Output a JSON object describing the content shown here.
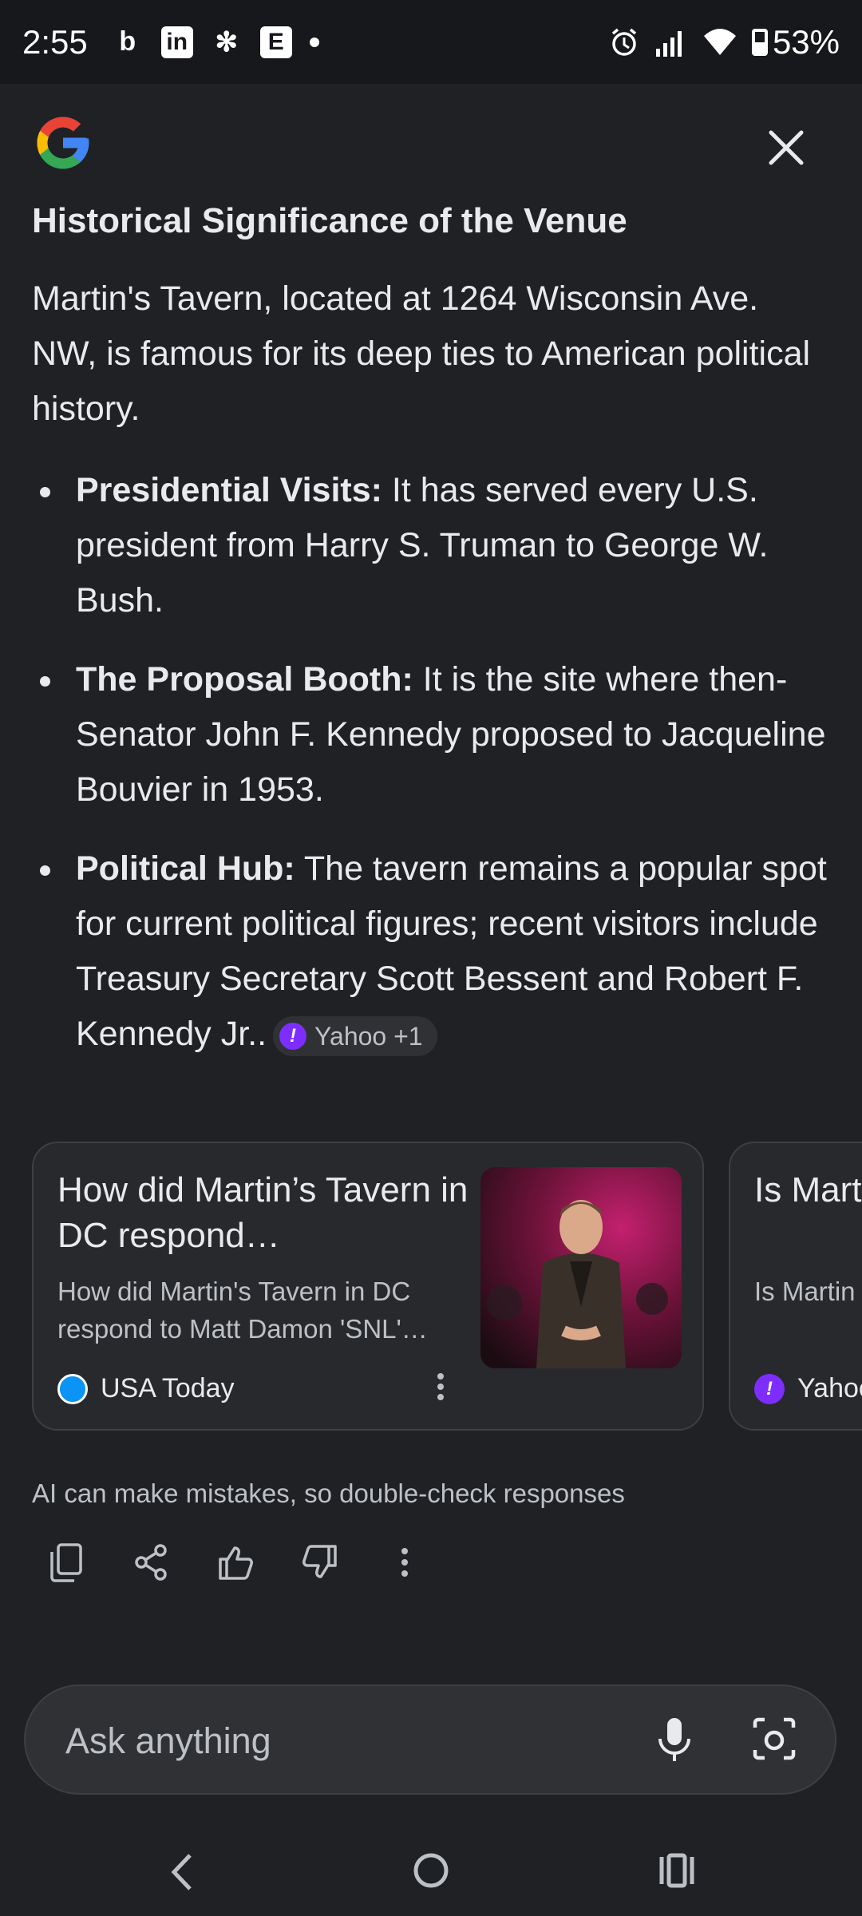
{
  "status_bar": {
    "time": "2:55",
    "battery": "53%",
    "app_icons": [
      "b",
      "in",
      "✻",
      "E"
    ]
  },
  "header": {
    "logo": "google-g-icon",
    "close_icon": "close-icon"
  },
  "content": {
    "heading": "Historical Significance of the Venue",
    "intro": "Martin's Tavern, located at 1264 Wisconsin Ave. NW, is famous for its deep ties to American political history.",
    "bullets": [
      {
        "label": "Presidential Visits:",
        "text": " It has served every U.S. president from Harry S. Truman to George W. Bush."
      },
      {
        "label": "The Proposal Booth:",
        "text": " It is the site where then-Senator John F. Kennedy proposed to Jacqueline Bouvier in 1953."
      },
      {
        "label": "Political Hub:",
        "text": " The tavern remains a popular spot for current political figures; recent visitors include Treasury Secretary Scott Bessent and Robert F. Kennedy Jr.."
      }
    ],
    "source_chip": "Yahoo +1"
  },
  "cards": [
    {
      "title": "How did Martin’s Tavern in DC respond…",
      "snippet": "How did Martin's Tavern in DC respond to Matt Damon 'SNL'…",
      "source": "USA Today"
    },
    {
      "title": "Is Mart 'SNL' s",
      "snippet": "Is Martin sketch a",
      "source": "Yahoo"
    }
  ],
  "disclaimer": "AI can make mistakes, so double-check responses",
  "actions": [
    "copy-icon",
    "share-icon",
    "thumbs-up-icon",
    "thumbs-down-icon",
    "more-vert-icon"
  ],
  "ask_bar": {
    "placeholder": "Ask anything"
  },
  "colors": {
    "background": "#202124",
    "card": "#28292c",
    "text": "#e8eaed",
    "muted": "#bdc1c6",
    "yahoo": "#7d2eff",
    "usa_today": "#0b93f6"
  }
}
